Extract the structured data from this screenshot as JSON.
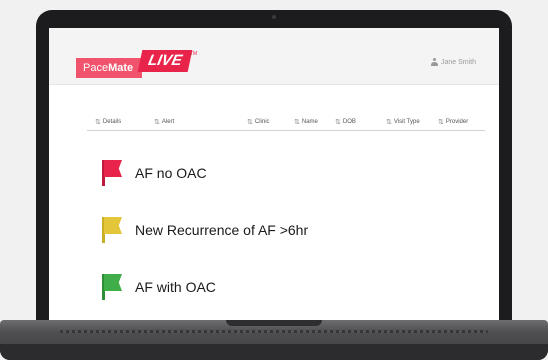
{
  "app": {
    "logo_main": "Pace",
    "logo_main_bold": "Mate",
    "logo_live": "LIVE",
    "logo_tm": "TM",
    "brand_color": "#e8244a"
  },
  "user": {
    "name": "Jane Smith",
    "icon": "user-icon"
  },
  "table": {
    "sort_icon": "⇅",
    "columns": [
      {
        "label": "Details",
        "key": "details"
      },
      {
        "label": "Alert",
        "key": "alert"
      },
      {
        "label": "Clinic",
        "key": "clinic"
      },
      {
        "label": "Name",
        "key": "name"
      },
      {
        "label": "DOB",
        "key": "dob"
      },
      {
        "label": "Visit Type",
        "key": "visit-type"
      },
      {
        "label": "Provider",
        "key": "provider"
      }
    ]
  },
  "legend": [
    {
      "label": "AF no OAC",
      "color": "#e8244a",
      "pole": "#c01b3c",
      "icon": "red-flag-icon"
    },
    {
      "label": "New Recurrence of AF >6hr",
      "color": "#e3c63a",
      "pole": "#c9ad24",
      "icon": "yellow-flag-icon"
    },
    {
      "label": "AF with OAC",
      "color": "#3fae49",
      "pole": "#2e8f36",
      "icon": "green-flag-icon"
    }
  ]
}
